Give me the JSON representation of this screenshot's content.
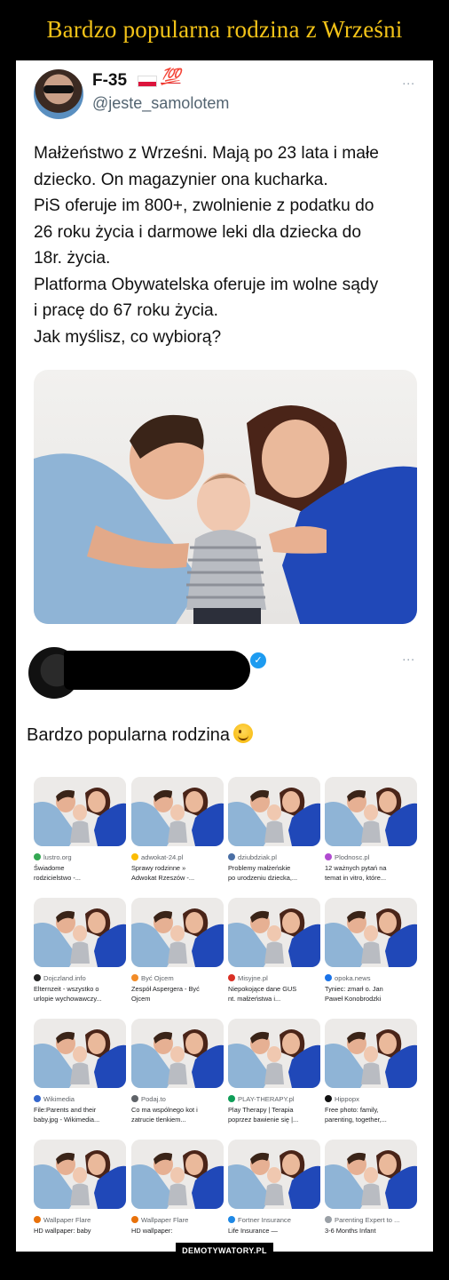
{
  "page_title": "Bardzo popularna rodzina z Wrześni",
  "tweet": {
    "name": "F-35",
    "badge": "💯",
    "handle": "@jeste_samolotem",
    "more": "...",
    "lines": [
      "Małżeństwo z Wrześni. Mają po 23 lata i małe",
      "dziecko. On magazynier ona kucharka.",
      "PiS oferuje im 800+, zwolnienie z podatku do",
      "26 roku życia i darmowe leki dla dziecka do",
      "18r. życia.",
      "Platforma Obywatelska oferuje im wolne sądy",
      "i pracę do 67 roku życia.",
      "Jak myślisz, co wybiorą?"
    ]
  },
  "reply": {
    "more": "...",
    "text": "Bardzo popularna rodzina"
  },
  "results": [
    {
      "source": "lustro.org",
      "favicon_color": "#34a853",
      "caption": [
        "Świadome",
        "rodzicielstwo -..."
      ]
    },
    {
      "source": "adwokat-24.pl",
      "favicon_color": "#fbbc04",
      "caption": [
        "Sprawy rodzinne »",
        "Adwokat Rzeszów -..."
      ]
    },
    {
      "source": "dziubdziak.pl",
      "favicon_color": "#4a6fa5",
      "caption": [
        "Problemy małżeńskie",
        "po urodzeniu dziecka,..."
      ]
    },
    {
      "source": "Plodnosc.pl",
      "favicon_color": "#b04bd0",
      "caption": [
        "12 ważnych pytań na",
        "temat in vitro, które..."
      ]
    },
    {
      "source": "Dojczland.info",
      "favicon_color": "#222222",
      "caption": [
        "Elternzeit - wszystko o",
        "urlopie wychowawczy..."
      ]
    },
    {
      "source": "Być Ojcem",
      "favicon_color": "#f28c28",
      "caption": [
        "Zespół Aspergera - Być",
        "Ojcem"
      ]
    },
    {
      "source": "Misyjne.pl",
      "favicon_color": "#d93025",
      "caption": [
        "Niepokojące dane GUS",
        "nt. małżeństwa i..."
      ]
    },
    {
      "source": "opoka.news",
      "favicon_color": "#1a73e8",
      "caption": [
        "Tyniec: zmarł o. Jan",
        "Paweł Konobrodzki"
      ]
    },
    {
      "source": "Wikimedia",
      "favicon_color": "#3366cc",
      "caption": [
        "File:Parents and their",
        "baby.jpg - Wikimedia..."
      ]
    },
    {
      "source": "Podaj.to",
      "favicon_color": "#5f6368",
      "caption": [
        "Co ma wspólnego kot i",
        "zatrucie tlenkiem..."
      ]
    },
    {
      "source": "PLAY-THERAPY.pl",
      "favicon_color": "#0f9d58",
      "caption": [
        "Play Therapy | Terapia",
        "poprzez bawienie się |..."
      ]
    },
    {
      "source": "Hippopx",
      "favicon_color": "#111111",
      "caption": [
        "Free photo: family,",
        "parenting, together,..."
      ]
    },
    {
      "source": "Wallpaper Flare",
      "favicon_color": "#e8710a",
      "caption": [
        "HD wallpaper: baby",
        ""
      ]
    },
    {
      "source": "Wallpaper Flare",
      "favicon_color": "#e8710a",
      "caption": [
        "HD wallpaper:",
        ""
      ]
    },
    {
      "source": "Fortner Insurance",
      "favicon_color": "#1e88e5",
      "caption": [
        "Life Insurance —",
        ""
      ]
    },
    {
      "source": "Parenting Expert to ...",
      "favicon_color": "#9aa0a6",
      "caption": [
        "3-6 Months Infant",
        ""
      ]
    }
  ],
  "watermark": "DEMOTYWATORY.PL",
  "colors": {
    "title": "#f3c318",
    "handle": "#536471",
    "verified": "#1d9bf0"
  }
}
